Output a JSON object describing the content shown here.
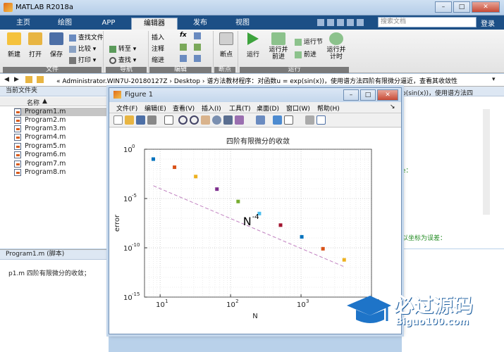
{
  "window": {
    "title": "MATLAB R2018a"
  },
  "tabs": [
    {
      "label": "主页"
    },
    {
      "label": "绘图"
    },
    {
      "label": "APP"
    },
    {
      "label": "编辑器"
    },
    {
      "label": "发布"
    },
    {
      "label": "视图"
    }
  ],
  "search": {
    "placeholder": "搜索文档"
  },
  "login_label": "登录",
  "ribbon": {
    "new": "新建",
    "open": "打开",
    "save": "保存",
    "find_file": "查找文件",
    "compare": "比较",
    "print": "打印",
    "goto": "转至",
    "find": "查找",
    "insert": "插入",
    "comment": "注释",
    "indent": "缩进",
    "breakpoint": "断点",
    "run": "运行",
    "run_advance": "运行并\n前进",
    "run_section": "运行节",
    "advance": "前进",
    "run_time": "运行并\n计时",
    "groups": {
      "file": "文件",
      "navigate": "导航",
      "edit": "编辑",
      "breakpoints": "断点",
      "run": "运行"
    }
  },
  "address": {
    "path": "« Administrator.WIN7U-20180127Z  ›  Desktop  ›  谱方法教材程序：对函数u = exp(sin(x))，使用谱方法四阶有限微分逼近，查看其收敛性"
  },
  "file_panel": {
    "title": "当前文件夹",
    "column": "名称",
    "files": [
      "Program1.m",
      "Program2.m",
      "Program3.m",
      "Program4.m",
      "Program5.m",
      "Program6.m",
      "Program7.m",
      "Program8.m"
    ]
  },
  "detail_panel": {
    "title": "Program1.m  (脚本)",
    "description": "p1.m 四阶有限微分的收敛；"
  },
  "editor_snippets": {
    "top": "p(sin(x))，使用谱方法四",
    "mid1": "e：",
    "mid2": "以坐标为误差："
  },
  "figure": {
    "title": "Figure 1",
    "menus": [
      "文件(F)",
      "编辑(E)",
      "查看(V)",
      "插入(I)",
      "工具(T)",
      "桌面(D)",
      "窗口(W)",
      "帮助(H)"
    ]
  },
  "watermark": {
    "text": "必过源码",
    "url": "Biguo100.com"
  },
  "chart_data": {
    "type": "scatter",
    "title": "四阶有限微分的收敛",
    "xlabel": "N",
    "ylabel": "error",
    "xscale": "log",
    "yscale": "log",
    "xlim": [
      6,
      10000
    ],
    "ylim": [
      1e-15,
      1
    ],
    "xticks": [
      {
        "base": "10",
        "exp": "1"
      },
      {
        "base": "10",
        "exp": "2"
      },
      {
        "base": "10",
        "exp": "3"
      },
      {
        "base": "10",
        "exp": "4"
      }
    ],
    "yticks": [
      {
        "base": "10",
        "exp": "0"
      },
      {
        "base": "10",
        "exp": "-5"
      },
      {
        "base": "10",
        "exp": "-10"
      },
      {
        "base": "10",
        "exp": "-15"
      }
    ],
    "grid": true,
    "points": [
      {
        "x": 8,
        "y": 0.1,
        "color": "#0072bd"
      },
      {
        "x": 16,
        "y": 0.015,
        "color": "#d95319"
      },
      {
        "x": 32,
        "y": 0.0017,
        "color": "#edb120"
      },
      {
        "x": 64,
        "y": 9e-05,
        "color": "#7e2f8e"
      },
      {
        "x": 128,
        "y": 5e-06,
        "color": "#77ac30"
      },
      {
        "x": 256,
        "y": 3e-07,
        "color": "#4dbeee"
      },
      {
        "x": 512,
        "y": 2e-08,
        "color": "#a2142f"
      },
      {
        "x": 1024,
        "y": 1.3e-09,
        "color": "#0072bd"
      },
      {
        "x": 2048,
        "y": 8e-11,
        "color": "#d95319"
      },
      {
        "x": 4096,
        "y": 6e-12,
        "color": "#edb120"
      }
    ],
    "reference_line": {
      "x": [
        8,
        4096
      ],
      "y": [
        0.0002,
        1.2e-12
      ],
      "style": "dashed",
      "color": "#c080c0"
    },
    "annotation": {
      "base": "N",
      "exp": "-4",
      "x": 150,
      "y": 2e-08
    }
  }
}
